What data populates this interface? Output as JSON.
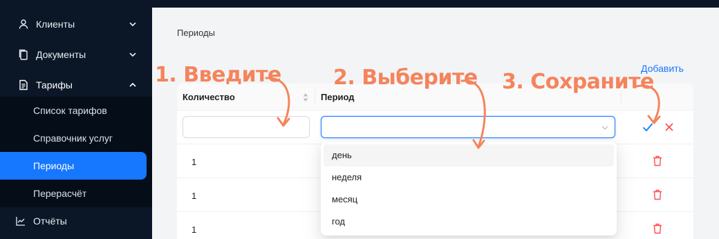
{
  "sidebar": {
    "items": [
      {
        "label": "Клиенты",
        "icon": "user-icon"
      },
      {
        "label": "Документы",
        "icon": "documents-icon"
      },
      {
        "label": "Тарифы",
        "icon": "tariff-document-icon"
      }
    ],
    "submenu": [
      {
        "label": "Список тарифов"
      },
      {
        "label": "Справочник услуг"
      },
      {
        "label": "Периоды",
        "active": true
      },
      {
        "label": "Перерасчёт"
      }
    ],
    "reports": {
      "label": "Отчёты",
      "icon": "chart-line-icon"
    }
  },
  "page": {
    "title": "Периоды",
    "add_label": "Добавить"
  },
  "table": {
    "columns": [
      "Количество",
      "Период"
    ],
    "edit_row": {
      "quantity_value": "",
      "period_value": ""
    },
    "rows": [
      {
        "quantity": "1"
      },
      {
        "quantity": "1"
      },
      {
        "quantity": "1"
      }
    ]
  },
  "dropdown": {
    "options": [
      "день",
      "неделя",
      "месяц",
      "год"
    ],
    "hovered": "день"
  },
  "annotations": {
    "step1": "1. Введите",
    "step2": "2. Выберите",
    "step3": "3. Сохраните"
  },
  "colors": {
    "sidebar_bg": "#0b1727",
    "accent": "#1677ff",
    "annotation": "#f4845c",
    "danger": "#ff4d4f"
  }
}
